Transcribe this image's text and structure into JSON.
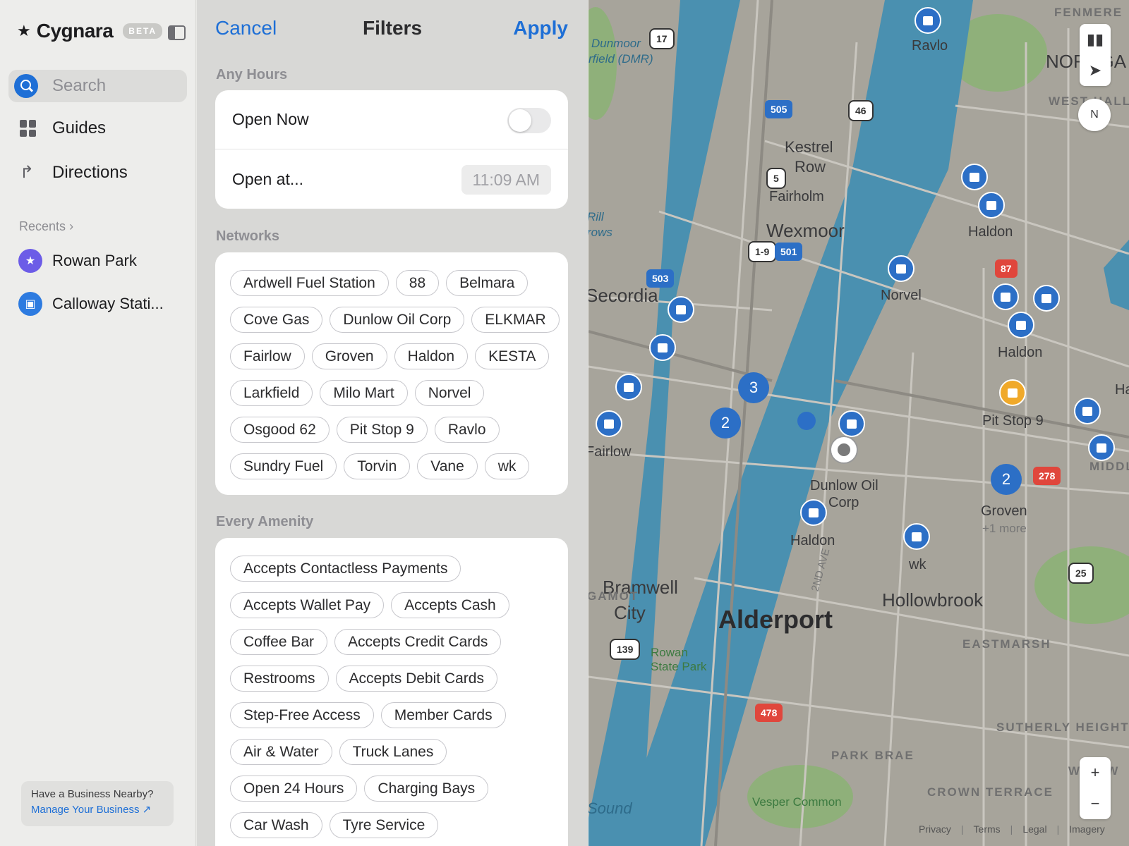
{
  "app": {
    "name": "Cygnara",
    "badge": "BETA"
  },
  "sidebar": {
    "search_placeholder": "Search",
    "nav": [
      {
        "label": "Guides",
        "icon": "grid-icon"
      },
      {
        "label": "Directions",
        "icon": "directions-icon"
      }
    ],
    "recents_label": "Recents",
    "recents": [
      {
        "label": "Rowan Park",
        "icon": "star-icon"
      },
      {
        "label": "Calloway Stati...",
        "icon": "train-icon"
      }
    ],
    "business": {
      "title": "Have a Business Nearby?",
      "link": "Manage Your Business ↗"
    }
  },
  "filters": {
    "cancel": "Cancel",
    "title": "Filters",
    "apply": "Apply",
    "hours_section": "Any Hours",
    "open_now": "Open Now",
    "open_now_on": false,
    "open_at": "Open at...",
    "open_at_time": "11:09 AM",
    "networks_section": "Networks",
    "networks": [
      "Ardwell Fuel Station",
      "88",
      "Belmara",
      "Cove Gas",
      "Dunlow Oil Corp",
      "ELKMAR",
      "Fairlow",
      "Groven",
      "Haldon",
      "KESTA",
      "Larkfield",
      "Milo Mart",
      "Norvel",
      "Osgood 62",
      "Pit Stop 9",
      "Ravlo",
      "Sundry Fuel",
      "Torvin",
      "Vane",
      "wk"
    ],
    "amenity_section": "Every Amenity",
    "amenities": [
      "Accepts Contactless Payments",
      "Accepts Wallet Pay",
      "Accepts Cash",
      "Coffee Bar",
      "Accepts Credit Cards",
      "Restrooms",
      "Accepts Debit Cards",
      "Step-Free Access",
      "Member Cards",
      "Air & Water",
      "Truck Lanes",
      "Open 24 Hours",
      "Charging Bays",
      "Car Wash",
      "Tyre Service"
    ]
  },
  "map": {
    "labels": {
      "fenmere": "FENMERE",
      "nora": "NORRGA",
      "westhallo": "WEST HALLO",
      "ravlo": "Ravlo",
      "dunmoor": "Dunmoor",
      "airfield": "rfield (DMR)",
      "kestrel": "Kestrel",
      "row": "Row",
      "fairholm": "Fairholm",
      "wexmoor": "Wexmoor",
      "haldon1": "Haldon",
      "norvel": "Norvel",
      "haldon2": "Haldon",
      "secordia": "Secordia",
      "rill": "Rill",
      "rows": "rows",
      "fairlow": "Fairlow",
      "pitstop": "Pit Stop 9",
      "dunlow1": "Dunlow Oil",
      "dunlow2": "Corp",
      "haldon3": "Haldon",
      "wk": "wk",
      "groven": "Groven",
      "more": "+1 more",
      "ha": "Ha",
      "middl": "MIDDLE",
      "bramwell": "Bramwell",
      "city": "City",
      "gamot": "GAMOT",
      "alderport": "Alderport",
      "hollowbrook": "Hollowbrook",
      "eastmarsh": "EASTMARSH",
      "rowan1": "Rowan",
      "rowan2": "State Park",
      "second_ave": "2ND AVE",
      "sutherly": "SUTHERLY HEIGHTS",
      "parkbrae": "PARK BRAE",
      "crown": "CROWN TERRACE",
      "sound": "Sound",
      "vesper": "Vesper Common",
      "wrow": "W    ROW"
    },
    "shields": {
      "s17": "17",
      "s505": "505",
      "s46": "46",
      "s5": "5",
      "s19": "1-9",
      "s501": "501",
      "s503": "503",
      "s87": "87",
      "s278": "278",
      "s25": "25",
      "s139": "139",
      "s478": "478"
    },
    "clusters": {
      "c3": "3",
      "c2a": "2",
      "c2b": "2"
    },
    "compass": "N",
    "zoom_in": "+",
    "zoom_out": "−",
    "footer": [
      "Privacy",
      "Terms",
      "Legal",
      "Imagery"
    ]
  },
  "colors": {
    "accent": "#1e6fd6",
    "water": "#4a90b0",
    "land": "#a7a49b",
    "park": "#8fb07a",
    "pin": "#2c6fc6",
    "red_shield": "#e0463c"
  }
}
